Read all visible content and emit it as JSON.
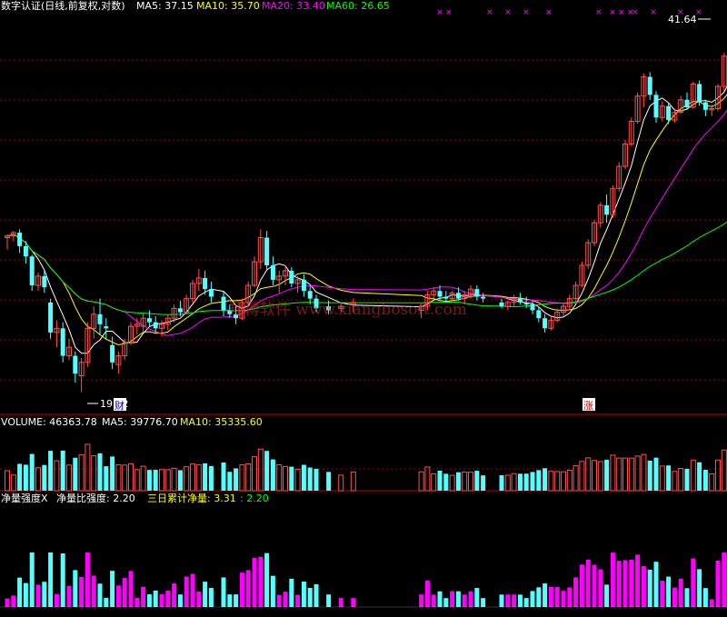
{
  "header": {
    "title": "数字认证(日线,前复权,对数)",
    "ma5_label": "MA5: 37.15",
    "ma10_label": "MA10: 35.70",
    "ma20_label": "MA20: 33.40",
    "ma60_label": "MA60: 26.65"
  },
  "volume_header": {
    "volume_label": "VOLUME: 46363.78",
    "ma5_label": "MA5: 39776.70",
    "ma10_label": "MA10: 35335.60"
  },
  "indicator_header": {
    "label1": "净量强度X",
    "label2": "净量比强度: 2.20",
    "label3": "三日累计净量: 3.31",
    "label4": ": 2.20"
  },
  "annotations": {
    "high_label": "41.64",
    "low_label": "19.22",
    "badge_cai": "财",
    "badge_zhang": "涨"
  },
  "watermark": "翔博软件 www.xiangbosoft.com",
  "colors": {
    "up": "#ff5050",
    "down": "#54ffff",
    "ma5": "#ffffff",
    "ma10": "#ffff00",
    "ma20": "#ff00ff",
    "ma60": "#00ff00",
    "grid": "#a00000",
    "magenta": "#ff00ff"
  },
  "chart_data": {
    "type": "candlestick",
    "log_scale": true,
    "price_range": [
      18.5,
      44
    ],
    "high_value": 41.64,
    "low_value": 19.22,
    "candles": [
      [
        27.0,
        27.2,
        26.3,
        27.1
      ],
      [
        27.1,
        27.4,
        26.8,
        27.3
      ],
      [
        27.3,
        27.5,
        26.1,
        26.5
      ],
      [
        26.5,
        26.8,
        25.5,
        25.9
      ],
      [
        25.9,
        26.0,
        24.0,
        24.3
      ],
      [
        24.3,
        25.0,
        24.0,
        24.8
      ],
      [
        24.8,
        25.1,
        23.9,
        24.2
      ],
      [
        23.4,
        23.6,
        21.6,
        21.9
      ],
      [
        21.9,
        22.5,
        21.2,
        22.1
      ],
      [
        22.1,
        22.4,
        20.5,
        20.8
      ],
      [
        20.8,
        21.6,
        20.6,
        21.2
      ],
      [
        20.8,
        21.0,
        19.6,
        20.0
      ],
      [
        19.9,
        20.7,
        19.2,
        20.5
      ],
      [
        20.5,
        22.4,
        20.3,
        22.1
      ],
      [
        22.1,
        23.2,
        21.6,
        22.8
      ],
      [
        22.8,
        23.6,
        21.8,
        22.3
      ],
      [
        22.2,
        22.6,
        21.6,
        22.1
      ],
      [
        21.3,
        21.7,
        20.2,
        20.5
      ],
      [
        20.4,
        21.0,
        20.0,
        20.8
      ],
      [
        20.8,
        21.6,
        20.6,
        21.4
      ],
      [
        21.4,
        22.4,
        21.3,
        22.2
      ],
      [
        22.2,
        22.6,
        21.8,
        22.3
      ],
      [
        22.2,
        22.9,
        21.9,
        22.6
      ],
      [
        22.6,
        23.0,
        22.2,
        22.4
      ],
      [
        22.4,
        22.7,
        21.9,
        22.1
      ],
      [
        22.1,
        22.5,
        21.7,
        22.3
      ],
      [
        22.3,
        22.8,
        22.0,
        22.6
      ],
      [
        22.6,
        23.3,
        22.4,
        23.1
      ],
      [
        23.1,
        23.5,
        22.7,
        22.9
      ],
      [
        22.9,
        23.8,
        22.8,
        23.6
      ],
      [
        23.6,
        24.6,
        23.4,
        24.4
      ],
      [
        24.4,
        25.2,
        24.0,
        24.7
      ],
      [
        24.7,
        25.1,
        23.8,
        24.1
      ],
      [
        24.1,
        24.5,
        23.4,
        23.7
      ],
      null,
      [
        23.7,
        24.0,
        22.7,
        23.0
      ],
      [
        23.0,
        23.3,
        22.6,
        22.8
      ],
      [
        22.8,
        23.2,
        22.3,
        22.6
      ],
      [
        22.6,
        23.6,
        22.5,
        23.4
      ],
      [
        23.4,
        24.5,
        23.3,
        24.3
      ],
      [
        24.3,
        25.9,
        24.2,
        25.6
      ],
      [
        25.6,
        27.5,
        25.2,
        27.0
      ],
      [
        27.0,
        27.4,
        25.1,
        25.4
      ],
      [
        25.4,
        25.9,
        24.3,
        24.6
      ],
      [
        24.6,
        25.1,
        23.9,
        24.8
      ],
      [
        24.8,
        25.4,
        24.3,
        25.1
      ],
      [
        25.1,
        25.3,
        24.2,
        24.4
      ],
      [
        24.4,
        24.8,
        23.9,
        24.6
      ],
      [
        24.6,
        24.9,
        23.7,
        24.0
      ],
      [
        24.0,
        24.3,
        23.3,
        23.6
      ],
      [
        23.6,
        23.8,
        22.9,
        23.1
      ],
      null,
      [
        23.2,
        23.5,
        22.8,
        23.0
      ],
      null,
      [
        23.1,
        23.4,
        22.9,
        23.2
      ],
      null,
      [
        23.3,
        23.6,
        22.9,
        23.4
      ],
      null,
      null,
      null,
      null,
      null,
      null,
      null,
      null,
      null,
      null,
      [
        23.0,
        23.3,
        22.6,
        23.2
      ],
      [
        23.2,
        24.0,
        23.0,
        23.8
      ],
      [
        23.8,
        24.2,
        23.6,
        24.0
      ],
      [
        24.0,
        24.3,
        23.5,
        23.7
      ],
      [
        23.7,
        24.0,
        23.4,
        23.6
      ],
      [
        23.6,
        24.0,
        23.5,
        23.9
      ],
      [
        23.9,
        24.2,
        23.5,
        23.6
      ],
      [
        23.6,
        24.0,
        23.3,
        23.8
      ],
      [
        23.8,
        24.3,
        23.6,
        24.1
      ],
      [
        24.1,
        24.3,
        23.5,
        23.7
      ],
      [
        23.7,
        23.9,
        23.4,
        23.6
      ],
      null,
      null,
      [
        23.4,
        23.6,
        23.1,
        23.2
      ],
      [
        23.2,
        23.5,
        23.0,
        23.4
      ],
      [
        23.4,
        23.8,
        23.2,
        23.6
      ],
      [
        23.6,
        23.9,
        23.3,
        23.4
      ],
      [
        23.4,
        23.7,
        23.1,
        23.3
      ],
      [
        23.3,
        23.5,
        22.8,
        23.0
      ],
      [
        23.0,
        23.2,
        22.4,
        22.6
      ],
      [
        22.6,
        22.8,
        21.9,
        22.1
      ],
      [
        22.1,
        22.7,
        22.0,
        22.5
      ],
      [
        22.5,
        23.1,
        22.4,
        22.9
      ],
      [
        22.9,
        23.4,
        22.7,
        23.2
      ],
      [
        23.2,
        23.8,
        23.0,
        23.6
      ],
      [
        23.6,
        24.5,
        23.4,
        24.3
      ],
      [
        24.3,
        25.6,
        24.2,
        25.4
      ],
      [
        25.4,
        26.9,
        25.2,
        26.7
      ],
      [
        26.7,
        28.1,
        26.5,
        27.9
      ],
      [
        27.9,
        29.2,
        27.6,
        29.0
      ],
      [
        29.0,
        29.7,
        27.9,
        28.4
      ],
      [
        28.4,
        30.3,
        28.2,
        30.1
      ],
      [
        30.1,
        31.9,
        29.9,
        31.6
      ],
      [
        31.6,
        33.5,
        31.4,
        33.2
      ],
      [
        33.2,
        35.2,
        33.0,
        34.9
      ],
      [
        34.9,
        37.2,
        34.7,
        36.9
      ],
      [
        36.9,
        38.8,
        36.0,
        38.5
      ],
      [
        38.5,
        38.9,
        36.6,
        37.0
      ],
      [
        37.0,
        37.3,
        34.8,
        35.2
      ],
      [
        35.2,
        36.5,
        34.9,
        36.1
      ],
      [
        36.1,
        36.4,
        34.7,
        35.0
      ],
      [
        35.0,
        35.9,
        34.8,
        35.6
      ],
      [
        35.6,
        36.9,
        35.5,
        36.6
      ],
      [
        36.6,
        37.2,
        35.8,
        36.0
      ],
      [
        36.0,
        38.1,
        35.9,
        37.9
      ],
      [
        37.9,
        38.2,
        36.1,
        36.4
      ],
      [
        36.4,
        36.6,
        35.3,
        35.8
      ],
      [
        35.8,
        36.2,
        35.3,
        35.9
      ],
      [
        35.9,
        37.9,
        35.7,
        37.7
      ],
      [
        37.7,
        40.6,
        37.3,
        40.3
      ],
      [
        40.3,
        41.64,
        39.7,
        41.5
      ]
    ],
    "signal_markers_x": [
      480,
      490,
      535,
      555,
      575,
      600,
      655,
      670,
      680,
      690,
      695,
      715,
      745,
      765
    ]
  }
}
